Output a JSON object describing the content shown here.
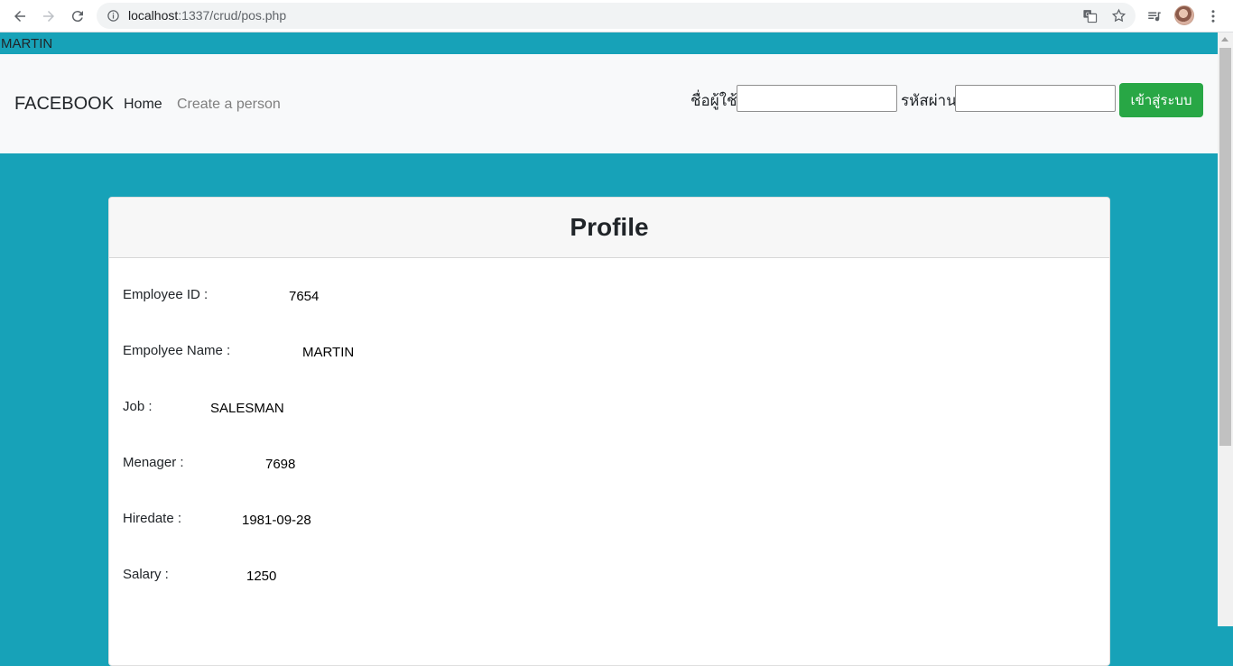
{
  "browser": {
    "url_host": "localhost",
    "url_rest": ":1337/crud/pos.php"
  },
  "top_strip": {
    "text": "MARTIN"
  },
  "navbar": {
    "brand": "FACEBOOK",
    "home": "Home",
    "create": "Create a person",
    "username_label": "ชื่อผู้ใช้",
    "password_label": "รหัสผ่าน",
    "login_button": "เข้าสู่ระบบ"
  },
  "card": {
    "title": "Profile",
    "fields": [
      {
        "label": "Employee ID :",
        "value": "7654"
      },
      {
        "label": "Empolyee Name :",
        "value": "MARTIN"
      },
      {
        "label": "Job :",
        "value": "SALESMAN"
      },
      {
        "label": "Menager :",
        "value": "7698"
      },
      {
        "label": "Hiredate :",
        "value": "1981-09-28"
      },
      {
        "label": "Salary :",
        "value": "1250"
      }
    ]
  },
  "colors": {
    "page_bg": "#17a2b8",
    "navbar_bg": "#f8f9fa",
    "login_button": "#28a745"
  },
  "icons": [
    "back-icon",
    "forward-icon",
    "reload-icon",
    "info-icon",
    "translate-icon",
    "star-icon",
    "media-icon",
    "menu-icon"
  ]
}
